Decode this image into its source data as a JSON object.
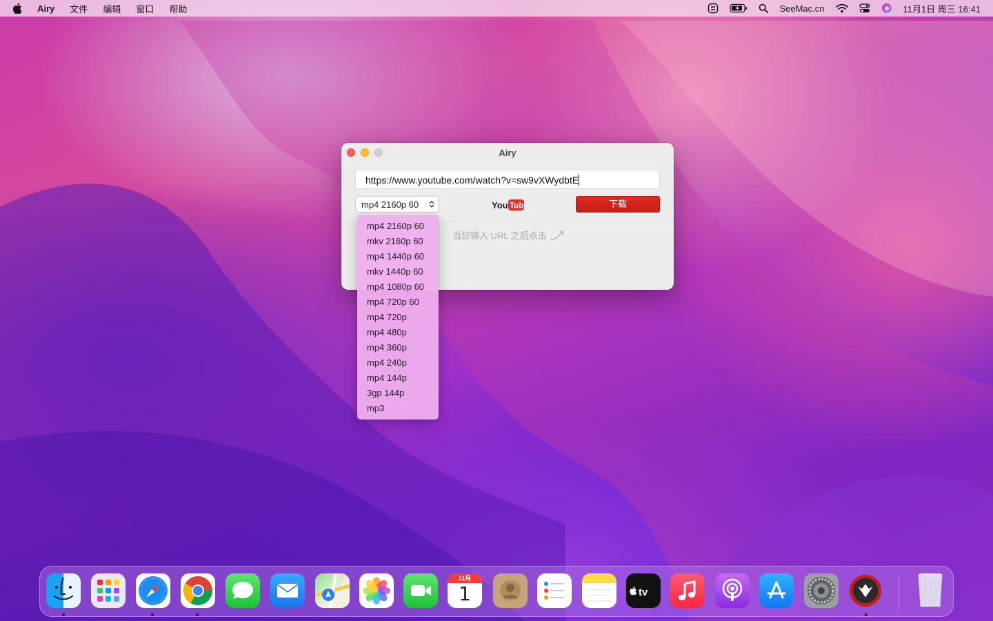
{
  "menubar": {
    "app_name": "Airy",
    "menus": [
      "文件",
      "编辑",
      "窗口",
      "帮助"
    ],
    "site": "SeeMac.cn",
    "datetime": "11月1日 周三  16:41"
  },
  "window": {
    "title": "Airy",
    "url_value": "https://www.youtube.com/watch?v=sw9vXWydbtE",
    "selected_format": "mp4 2160p 60",
    "download_label": "下载",
    "youtube_logo": {
      "you": "You",
      "tube": "Tube"
    },
    "hint": "当您输入 URL 之后点击"
  },
  "dropdown": {
    "options": [
      "mp4 2160p 60",
      "mkv 2160p 60",
      "mp4 1440p 60",
      "mkv 1440p 60",
      "mp4 1080p 60",
      "mp4 720p 60",
      "mp4 720p",
      "mp4 480p",
      "mp4 360p",
      "mp4 240p",
      "mp4 144p",
      "3gp 144p",
      "mp3"
    ]
  },
  "dock": {
    "calendar_month": "11月",
    "calendar_day": "1",
    "tv_label": "tv",
    "apps": [
      "finder-icon",
      "launchpad-icon",
      "safari-icon",
      "chrome-icon",
      "messages-icon",
      "mail-icon",
      "maps-icon",
      "photos-icon",
      "facetime-icon",
      "calendar-icon",
      "contacts-icon",
      "reminders-icon",
      "notes-icon",
      "appletv-icon",
      "music-icon",
      "podcasts-icon",
      "appstore-icon",
      "system-preferences-icon",
      "airy-icon",
      "trash-icon"
    ]
  },
  "colors": {
    "download_button": "#d0231c",
    "dropdown_bg": "#f0afee",
    "close": "#fe5f57",
    "minimize": "#febc2e"
  }
}
